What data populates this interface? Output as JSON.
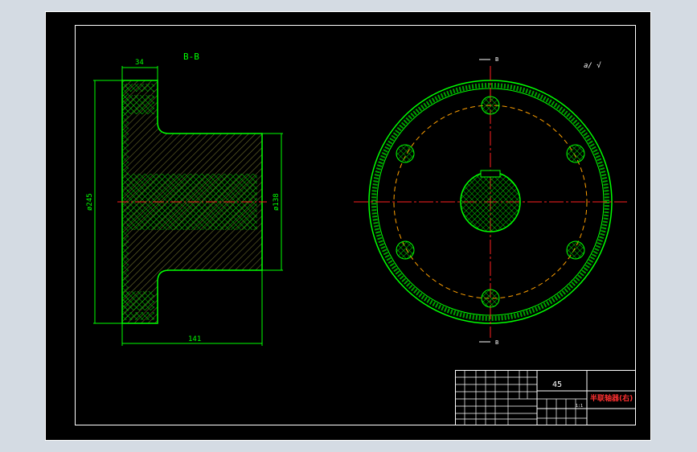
{
  "section_view": {
    "title": "B-B",
    "dim_flange_thickness": "34",
    "dim_outer_diameter": "ø245",
    "dim_hub_diameter": "ø138",
    "dim_length": "141"
  },
  "front_view": {
    "section_marker_top": "B",
    "section_marker_bottom": "B",
    "roughness_note": "a/ √"
  },
  "title_block": {
    "material": "45",
    "part_name": "半联轴器(右)",
    "scale": "1:1"
  },
  "colors": {
    "background": "#000000",
    "outline": "#00ff00",
    "hatch": "#00c000",
    "centerline": "#ff0000",
    "pitch_circle": "#ffa000",
    "title_text": "#ff3030",
    "dimension": "#00ff00",
    "frame": "#ffffff"
  }
}
